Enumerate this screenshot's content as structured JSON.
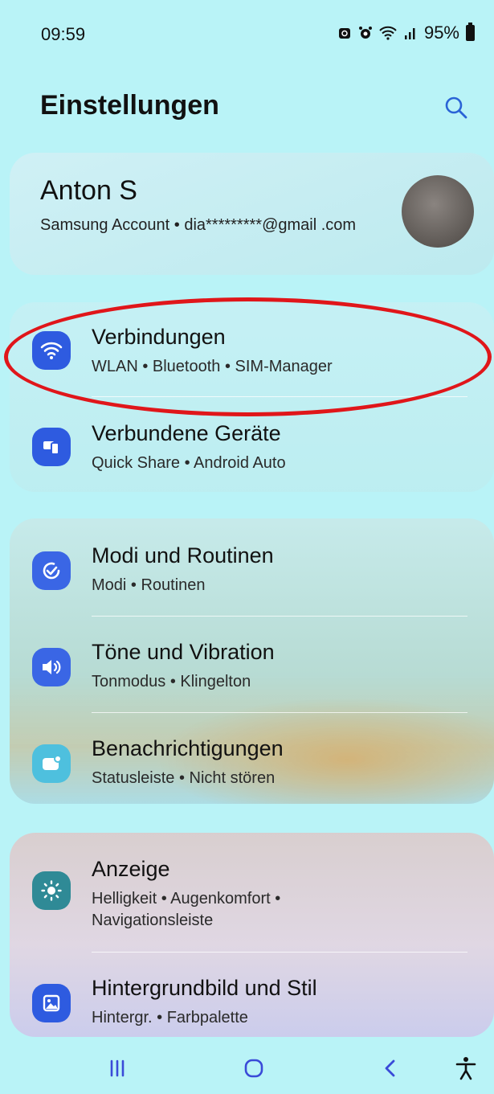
{
  "status_bar": {
    "time": "09:59",
    "battery": "95%",
    "icons": [
      "lock-icon",
      "alarm-icon",
      "wifi-icon",
      "signal-icon",
      "battery-icon"
    ]
  },
  "header": {
    "title": "Einstellungen",
    "search_icon": "search-icon"
  },
  "account": {
    "name": "Anton S",
    "subtitle": "Samsung Account • dia*********@gmail .com"
  },
  "groups": [
    {
      "items": [
        {
          "label": "Verbindungen",
          "sub": "WLAN • Bluetooth • SIM-Manager",
          "icon": "wifi-icon",
          "color": "#2e5be0"
        },
        {
          "label": "Verbundene Geräte",
          "sub": "Quick Share • Android Auto",
          "icon": "devices-icon",
          "color": "#2e5be0"
        }
      ]
    },
    {
      "items": [
        {
          "label": "Modi und Routinen",
          "sub": "Modi • Routinen",
          "icon": "routines-icon",
          "color": "#3a66e5"
        },
        {
          "label": "Töne und Vibration",
          "sub": "Tonmodus • Klingelton",
          "icon": "sound-icon",
          "color": "#3a66e5"
        },
        {
          "label": "Benachrichtigungen",
          "sub": "Statusleiste • Nicht stören",
          "icon": "notification-icon",
          "color": "#4ec0de"
        }
      ]
    },
    {
      "items": [
        {
          "label": "Anzeige",
          "sub_line1": "Helligkeit • Augenkomfort •",
          "sub_line2": "Navigationsleiste",
          "icon": "brightness-icon",
          "color": "#2f8a96"
        },
        {
          "label": "Hintergrundbild und Stil",
          "sub": "Hintergr. • Farbpalette",
          "icon": "wallpaper-icon",
          "color": "#2e5be0"
        }
      ]
    }
  ],
  "annotation": {
    "color": "#e0161a"
  },
  "navbar": [
    "recents-icon",
    "home-icon",
    "back-icon",
    "accessibility-icon"
  ]
}
